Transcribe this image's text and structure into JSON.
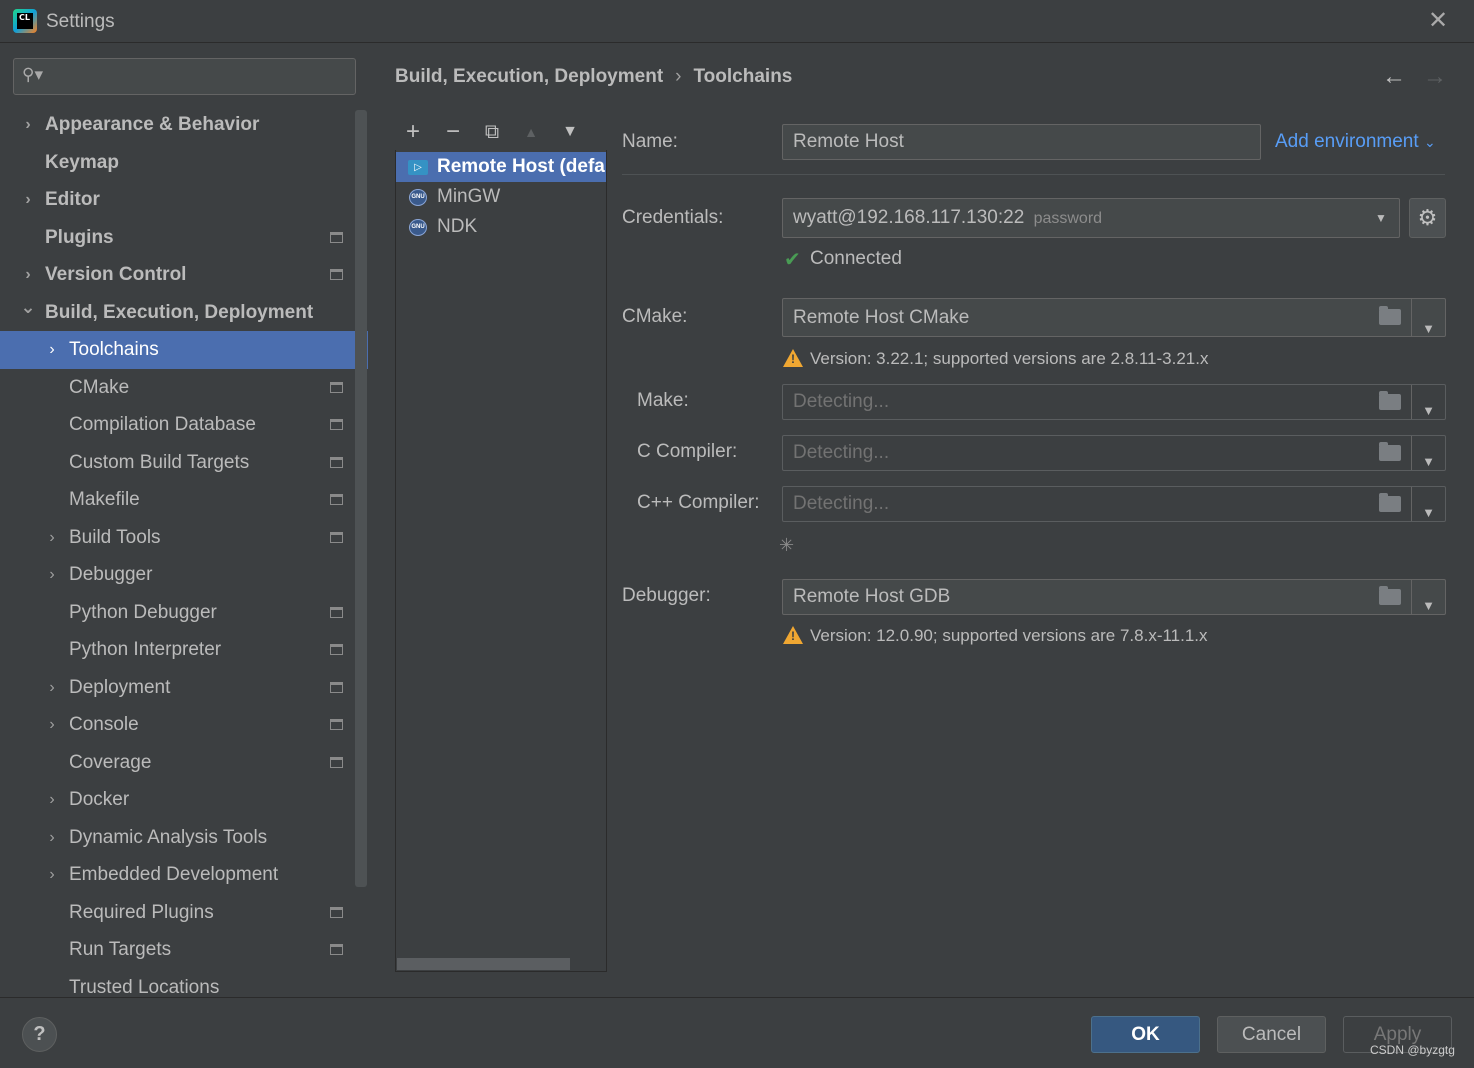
{
  "window": {
    "title": "Settings",
    "close_glyph": "✕"
  },
  "search": {
    "placeholder": "",
    "icon": "search-icon"
  },
  "sidebar": {
    "items": [
      {
        "label": "Appearance & Behavior",
        "chevron": "›",
        "level": 0,
        "bold": true,
        "project": false
      },
      {
        "label": "Keymap",
        "chevron": "",
        "level": 0,
        "bold": true,
        "project": false
      },
      {
        "label": "Editor",
        "chevron": "›",
        "level": 0,
        "bold": true,
        "project": false
      },
      {
        "label": "Plugins",
        "chevron": "",
        "level": 0,
        "bold": true,
        "project": true
      },
      {
        "label": "Version Control",
        "chevron": "›",
        "level": 0,
        "bold": true,
        "project": true
      },
      {
        "label": "Build, Execution, Deployment",
        "chevron": "⌄",
        "level": 0,
        "bold": true,
        "project": false
      },
      {
        "label": "Toolchains",
        "chevron": "›",
        "level": 1,
        "bold": false,
        "project": false,
        "selected": true
      },
      {
        "label": "CMake",
        "chevron": "",
        "level": 1,
        "bold": false,
        "project": true
      },
      {
        "label": "Compilation Database",
        "chevron": "",
        "level": 1,
        "bold": false,
        "project": true
      },
      {
        "label": "Custom Build Targets",
        "chevron": "",
        "level": 1,
        "bold": false,
        "project": true
      },
      {
        "label": "Makefile",
        "chevron": "",
        "level": 1,
        "bold": false,
        "project": true
      },
      {
        "label": "Build Tools",
        "chevron": "›",
        "level": 1,
        "bold": false,
        "project": true
      },
      {
        "label": "Debugger",
        "chevron": "›",
        "level": 1,
        "bold": false,
        "project": false
      },
      {
        "label": "Python Debugger",
        "chevron": "",
        "level": 1,
        "bold": false,
        "project": true
      },
      {
        "label": "Python Interpreter",
        "chevron": "",
        "level": 1,
        "bold": false,
        "project": true
      },
      {
        "label": "Deployment",
        "chevron": "›",
        "level": 1,
        "bold": false,
        "project": true
      },
      {
        "label": "Console",
        "chevron": "›",
        "level": 1,
        "bold": false,
        "project": true
      },
      {
        "label": "Coverage",
        "chevron": "",
        "level": 1,
        "bold": false,
        "project": true
      },
      {
        "label": "Docker",
        "chevron": "›",
        "level": 1,
        "bold": false,
        "project": false
      },
      {
        "label": "Dynamic Analysis Tools",
        "chevron": "›",
        "level": 1,
        "bold": false,
        "project": false
      },
      {
        "label": "Embedded Development",
        "chevron": "›",
        "level": 1,
        "bold": false,
        "project": false
      },
      {
        "label": "Required Plugins",
        "chevron": "",
        "level": 1,
        "bold": false,
        "project": true
      },
      {
        "label": "Run Targets",
        "chevron": "",
        "level": 1,
        "bold": false,
        "project": true
      },
      {
        "label": "Trusted Locations",
        "chevron": "",
        "level": 1,
        "bold": false,
        "project": false
      }
    ]
  },
  "breadcrumb": {
    "parent": "Build, Execution, Deployment",
    "separator": "›",
    "current": "Toolchains"
  },
  "nav": {
    "back": "←",
    "forward": "→"
  },
  "toolchains": {
    "toolbar": {
      "add": "+",
      "remove": "−",
      "copy": "⧉",
      "up": "▲",
      "down": "▼"
    },
    "items": [
      {
        "label": "Remote Host (defa",
        "icon": "remote-host-icon",
        "selected": true
      },
      {
        "label": "MinGW",
        "icon": "gnu-icon",
        "selected": false
      },
      {
        "label": "NDK",
        "icon": "gnu-icon",
        "selected": false
      }
    ],
    "gnu_icon_text": "GNU"
  },
  "form": {
    "name_label": "Name:",
    "name_value": "Remote Host",
    "add_environment": "Add environment",
    "add_environment_chevron": "⌄",
    "credentials_label": "Credentials:",
    "credentials_value": "wyatt@192.168.117.130:22",
    "credentials_hint": "password",
    "connected_text": "Connected",
    "cmake_label": "CMake:",
    "cmake_value": "Remote Host CMake",
    "cmake_warning": "Version: 3.22.1; supported versions are 2.8.11-3.21.x",
    "make_label": "Make:",
    "make_value": "Detecting...",
    "c_compiler_label": "C Compiler:",
    "c_compiler_value": "Detecting...",
    "cpp_compiler_label": "C++ Compiler:",
    "cpp_compiler_value": "Detecting...",
    "debugger_label": "Debugger:",
    "debugger_value": "Remote Host GDB",
    "debugger_warning": "Version: 12.0.90; supported versions are 7.8.x-11.1.x",
    "combo_arrow": "▼",
    "check_glyph": "✔",
    "warn_glyph": "!",
    "gear_glyph": "⚙",
    "spinner_glyph": "✳"
  },
  "buttons": {
    "help": "?",
    "ok": "OK",
    "cancel": "Cancel",
    "apply": "Apply"
  },
  "watermark": "CSDN @byzgtg",
  "colors": {
    "selection": "#4b6eaf",
    "link": "#589df6",
    "warning": "#f0a732",
    "success": "#499c54",
    "primary_button": "#365880"
  }
}
